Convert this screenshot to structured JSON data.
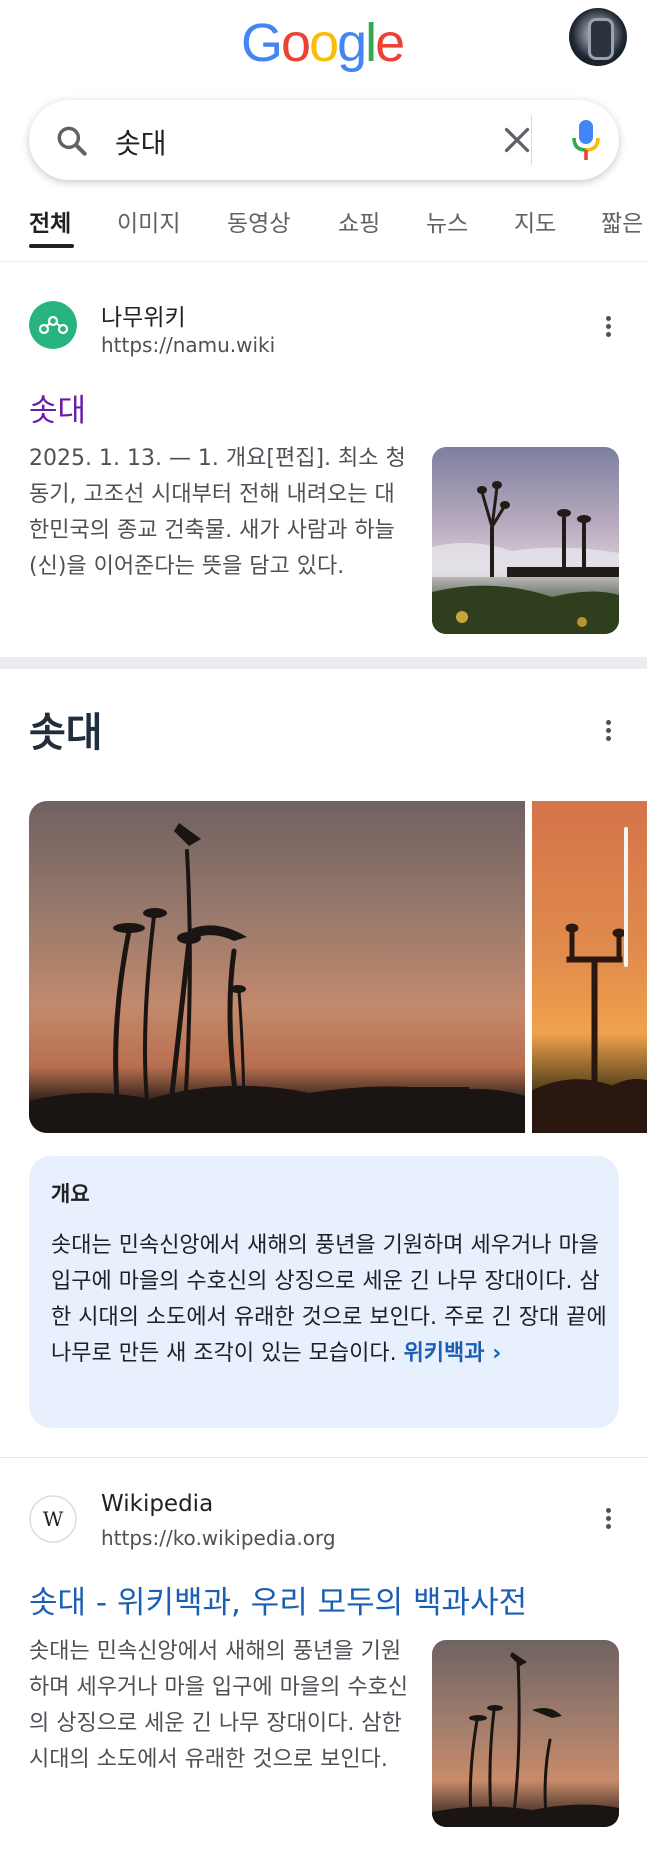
{
  "header": {
    "logo": "Google"
  },
  "search": {
    "query": "솟대"
  },
  "tabs": [
    "전체",
    "이미지",
    "동영상",
    "쇼핑",
    "뉴스",
    "지도",
    "짧은"
  ],
  "result1": {
    "site_name": "나무위키",
    "url": "https://namu.wiki",
    "title": "솟대",
    "snippet": "2025. 1. 13. — 1. 개요[편집]. 최소 청동기, 고조선 시대부터 전해 내려오는 대한민국의 종교 건축물. 새가 사람과 하늘(신)을 이어준다는 뜻을 담고 있다.",
    "title_color": "#681da8"
  },
  "knowledge_panel": {
    "title": "솟대",
    "summary_heading": "개요",
    "summary_text": "솟대는 민속신앙에서 새해의 풍년을 기원하며 세우거나 마을 입구에 마을의 수호신의 상징으로 세운 긴 나무 장대이다. 삼한 시대의 소도에서 유래한 것으로 보인다. 주로 긴 장대 끝에 나무로 만든 새 조각이 있는 모습이다.",
    "summary_link": "위키백과",
    "summary_link_arrow": "›"
  },
  "result2": {
    "site_name": "Wikipedia",
    "url": "https://ko.wikipedia.org",
    "title": "솟대 - 위키백과, 우리 모두의 백과사전",
    "snippet": "솟대는 민속신앙에서 새해의 풍년을 기원하며 세우거나 마을 입구에 마을의 수호신의 상징으로 세운 긴 나무 장대이다. 삼한 시대의 소도에서 유래한 것으로 보인다.",
    "title_color": "#1a5fb4",
    "icon_letter": "W"
  },
  "colors": {
    "google_blue": "#4285f4",
    "google_red": "#ea4335",
    "google_yellow": "#fbbc05",
    "google_green": "#34a853",
    "link_blue": "#1a5fb4",
    "visited_purple": "#681da8",
    "summary_bg": "#e8f0fe"
  },
  "icons": [
    "search-icon",
    "clear-icon",
    "mic-icon",
    "more-options-icon",
    "namuwiki-logo-icon",
    "wikipedia-logo-icon"
  ]
}
